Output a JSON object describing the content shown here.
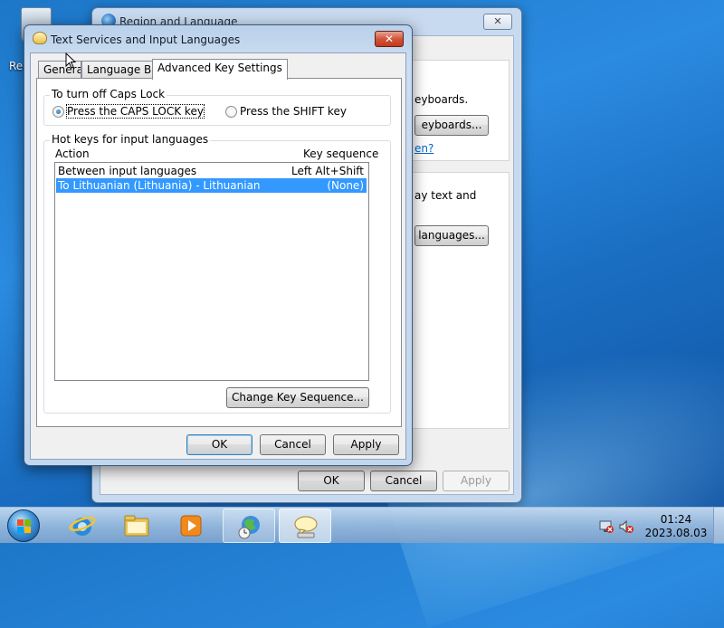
{
  "desktop": {
    "recycle_bin_label": "Rec"
  },
  "back_window": {
    "title": "Region and Language",
    "close_label": "✕",
    "partial_text_keyboards": "eyboards.",
    "btn_keyboards": "eyboards...",
    "link_question": "en?",
    "partial_text_display": "ay text and",
    "btn_languages": "languages...",
    "ok": "OK",
    "cancel": "Cancel",
    "apply": "Apply"
  },
  "dialog": {
    "title": "Text Services and Input Languages",
    "close_label": "✕",
    "tabs": [
      {
        "label": "General"
      },
      {
        "label": "Language Bar"
      },
      {
        "label": "Advanced Key Settings"
      }
    ],
    "caps_group": {
      "title": "To turn off Caps Lock",
      "option_caps": "Press the CAPS LOCK key",
      "option_shift": "Press the SHIFT key",
      "selected": "caps"
    },
    "hotkeys_group": {
      "title": "Hot keys for input languages",
      "col_action": "Action",
      "col_sequence": "Key sequence",
      "rows": [
        {
          "action": "Between input languages",
          "sequence": "Left Alt+Shift",
          "selected": false
        },
        {
          "action": "To Lithuanian (Lithuania) - Lithuanian",
          "sequence": "(None)",
          "selected": true
        }
      ],
      "change_button": "Change Key Sequence..."
    },
    "ok": "OK",
    "cancel": "Cancel",
    "apply": "Apply"
  },
  "taskbar": {
    "time": "01:24",
    "date": "2023.08.03",
    "apps": [
      "internet-explorer",
      "windows-explorer",
      "media-player",
      "region-and-language",
      "text-services"
    ]
  },
  "colors": {
    "selection": "#3399ff",
    "close_red": "#c23a1e",
    "desktop_blue": "#1d77c9"
  }
}
